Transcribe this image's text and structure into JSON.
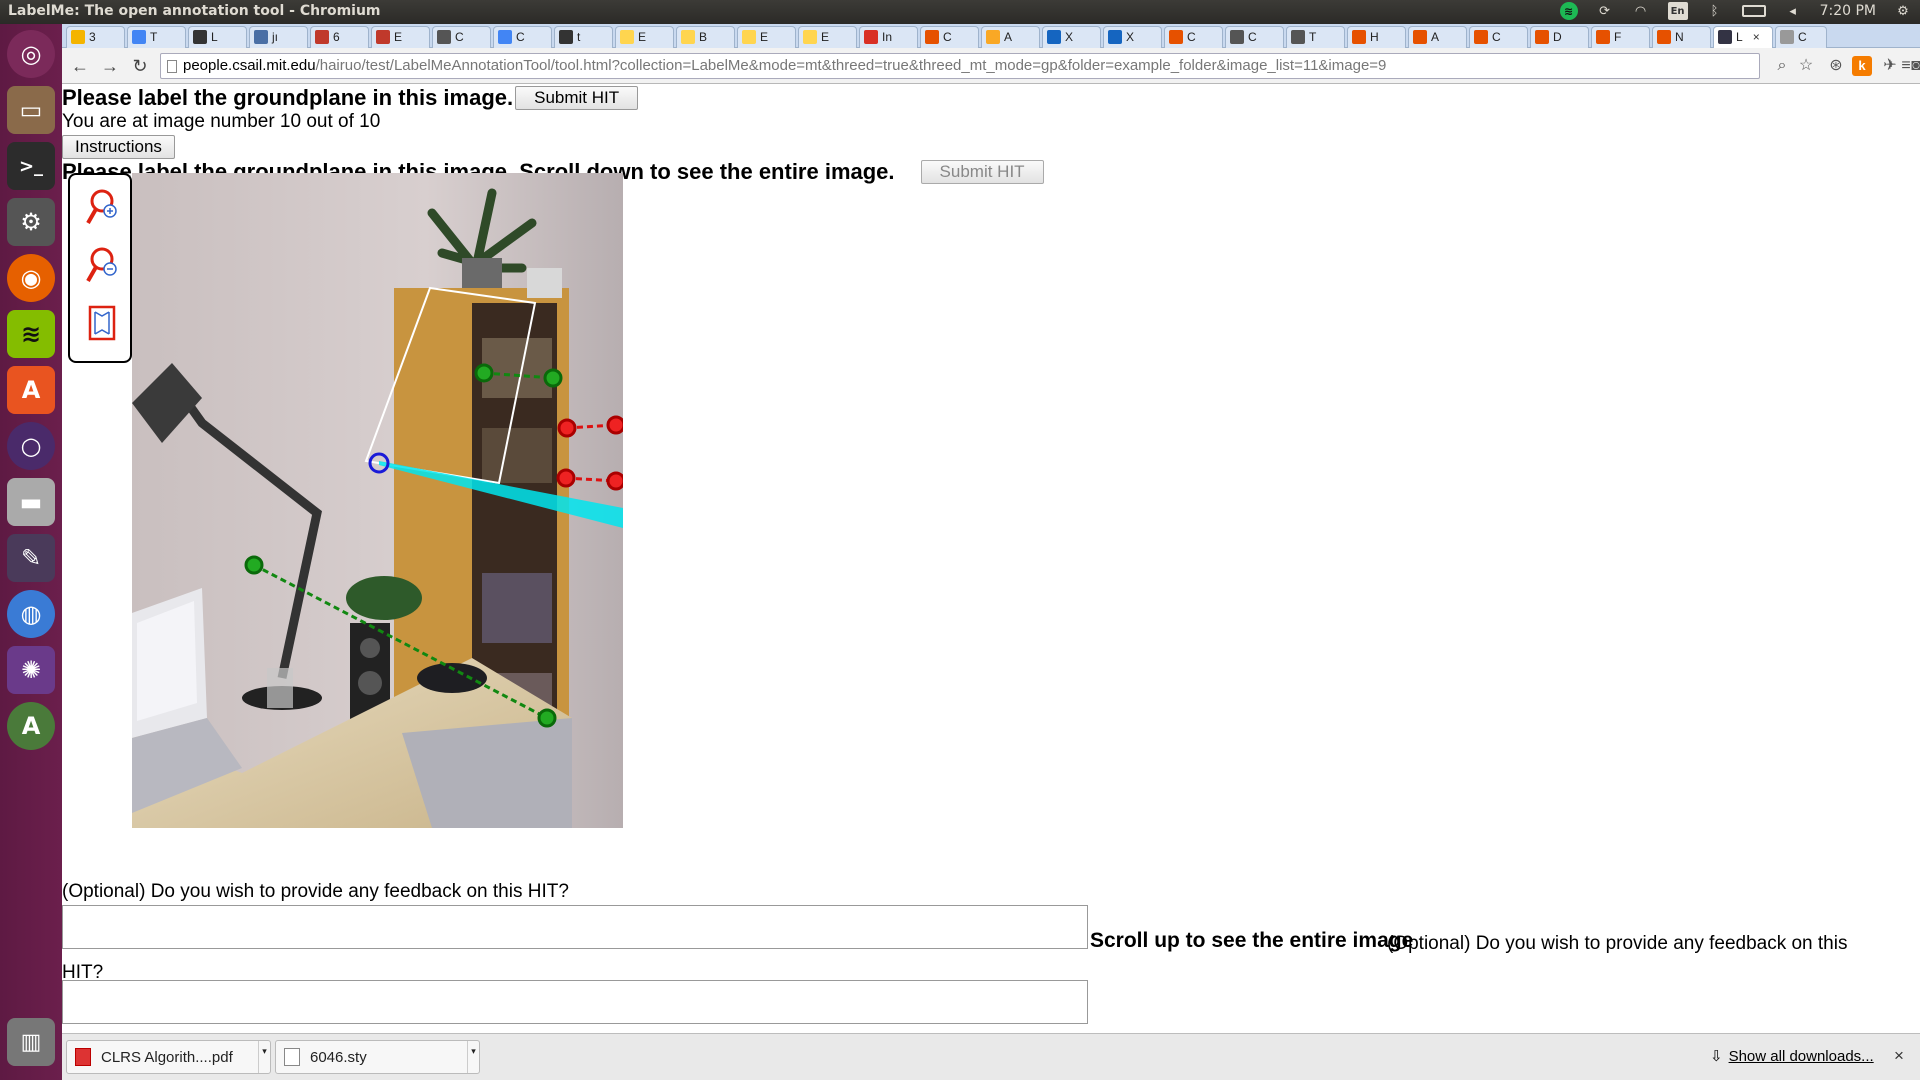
{
  "window": {
    "title": "LabelMe: The open annotation tool - Chromium",
    "clock": "7:20 PM",
    "lang": "En"
  },
  "launcher": {
    "items": [
      {
        "name": "ubuntu-dash",
        "glyph": "◎"
      },
      {
        "name": "files",
        "glyph": "▭"
      },
      {
        "name": "terminal",
        "glyph": ">_"
      },
      {
        "name": "system-settings",
        "glyph": "⚙"
      },
      {
        "name": "firefox",
        "glyph": "◉"
      },
      {
        "name": "spotify",
        "glyph": "≋"
      },
      {
        "name": "software-center",
        "glyph": "A"
      },
      {
        "name": "app-circle",
        "glyph": "○"
      },
      {
        "name": "drive",
        "glyph": "▬"
      },
      {
        "name": "text-editor",
        "glyph": "✎"
      },
      {
        "name": "chromium",
        "glyph": "◍"
      },
      {
        "name": "app-spiral",
        "glyph": "✺"
      },
      {
        "name": "software-updater",
        "glyph": "A"
      },
      {
        "name": "trash",
        "glyph": "🗑"
      }
    ]
  },
  "tabs": [
    {
      "label": "3",
      "color": "#f4b400"
    },
    {
      "label": "T",
      "color": "#4285f4"
    },
    {
      "label": "L",
      "color": "#333333"
    },
    {
      "label": "jı",
      "color": "#4a6fa5"
    },
    {
      "label": "6",
      "color": "#c0392b"
    },
    {
      "label": "E",
      "color": "#c0392b"
    },
    {
      "label": "C",
      "color": "#555555"
    },
    {
      "label": "C",
      "color": "#4285f4"
    },
    {
      "label": "t",
      "color": "#333333"
    },
    {
      "label": "E",
      "color": "#ffd54f"
    },
    {
      "label": "B",
      "color": "#ffd54f"
    },
    {
      "label": "E",
      "color": "#ffd54f"
    },
    {
      "label": "E",
      "color": "#ffd54f"
    },
    {
      "label": "In",
      "color": "#d93025"
    },
    {
      "label": "C",
      "color": "#e65100"
    },
    {
      "label": "A",
      "color": "#f9a825"
    },
    {
      "label": "X",
      "color": "#1565c0"
    },
    {
      "label": "X",
      "color": "#1565c0"
    },
    {
      "label": "C",
      "color": "#e65100"
    },
    {
      "label": "C",
      "color": "#555555"
    },
    {
      "label": "T",
      "color": "#555555"
    },
    {
      "label": "H",
      "color": "#e65100"
    },
    {
      "label": "A",
      "color": "#e65100"
    },
    {
      "label": "C",
      "color": "#e65100"
    },
    {
      "label": "D",
      "color": "#e65100"
    },
    {
      "label": "F",
      "color": "#e65100"
    },
    {
      "label": "N",
      "color": "#e65100"
    }
  ],
  "active_tab": {
    "label": "L",
    "close": "×"
  },
  "last_tab": {
    "label": "C"
  },
  "omnibox": {
    "host": "people.csail.mit.edu",
    "path": "/hairuo/test/LabelMeAnnotationTool/tool.html?collection=LabelMe&mode=mt&threed=true&threed_mt_mode=gp&folder=example_folder&image_list=11&image=9"
  },
  "page": {
    "heading": "Please label the groundplane in this image.",
    "submit_label": "Submit HIT",
    "image_counter": "You are at image number 10 out of 10",
    "instructions_label": "Instructions",
    "scroll_heading": "Please label the groundplane in this image. Scroll down to see the entire image.",
    "submit_label_2": "Submit HIT",
    "feedback_prompt": "(Optional) Do you wish to provide any feedback on this HIT?",
    "scroll_up": "Scroll up to see the entire image",
    "feedback_prompt_2": "(Optional) Do you wish to provide any feedback on this HIT?",
    "tools": [
      "zoom-in-icon",
      "zoom-out-icon",
      "fit-image-icon"
    ]
  },
  "downloads": {
    "items": [
      {
        "name": "CLRS Algorith....pdf",
        "type": "pdf"
      },
      {
        "name": "6046.sty",
        "type": "file"
      }
    ],
    "show_all": "Show all downloads...",
    "close": "×"
  }
}
